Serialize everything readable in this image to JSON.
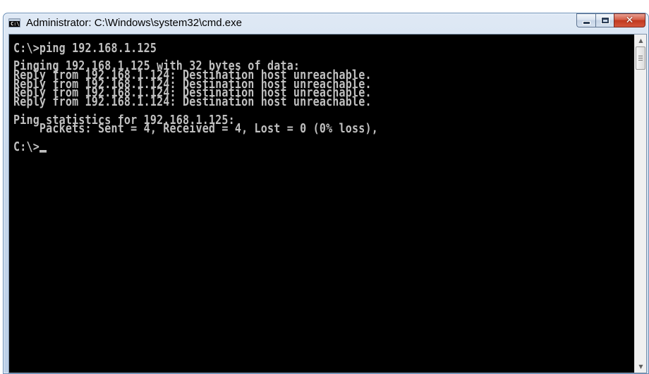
{
  "window": {
    "title": "Administrator: C:\\Windows\\system32\\cmd.exe",
    "icon": "cmd-icon",
    "icon_text": "C:\\",
    "controls": {
      "minimize": "minimize-icon",
      "maximize": "maximize-icon",
      "close": "close-icon",
      "close_glyph": "✕"
    }
  },
  "console": {
    "lines": [
      "C:\\>ping 192.168.1.125",
      "",
      "Pinging 192.168.1.125 with 32 bytes of data:",
      "Reply from 192.168.1.124: Destination host unreachable.",
      "Reply from 192.168.1.124: Destination host unreachable.",
      "Reply from 192.168.1.124: Destination host unreachable.",
      "Reply from 192.168.1.124: Destination host unreachable.",
      "",
      "Ping statistics for 192.168.1.125:",
      "    Packets: Sent = 4, Received = 4, Lost = 0 (0% loss),",
      ""
    ],
    "prompt": "C:\\>",
    "background": "#000000",
    "foreground": "#c0c0c0"
  },
  "scrollbar": {
    "up_arrow": "▲",
    "down_arrow": "▼"
  }
}
